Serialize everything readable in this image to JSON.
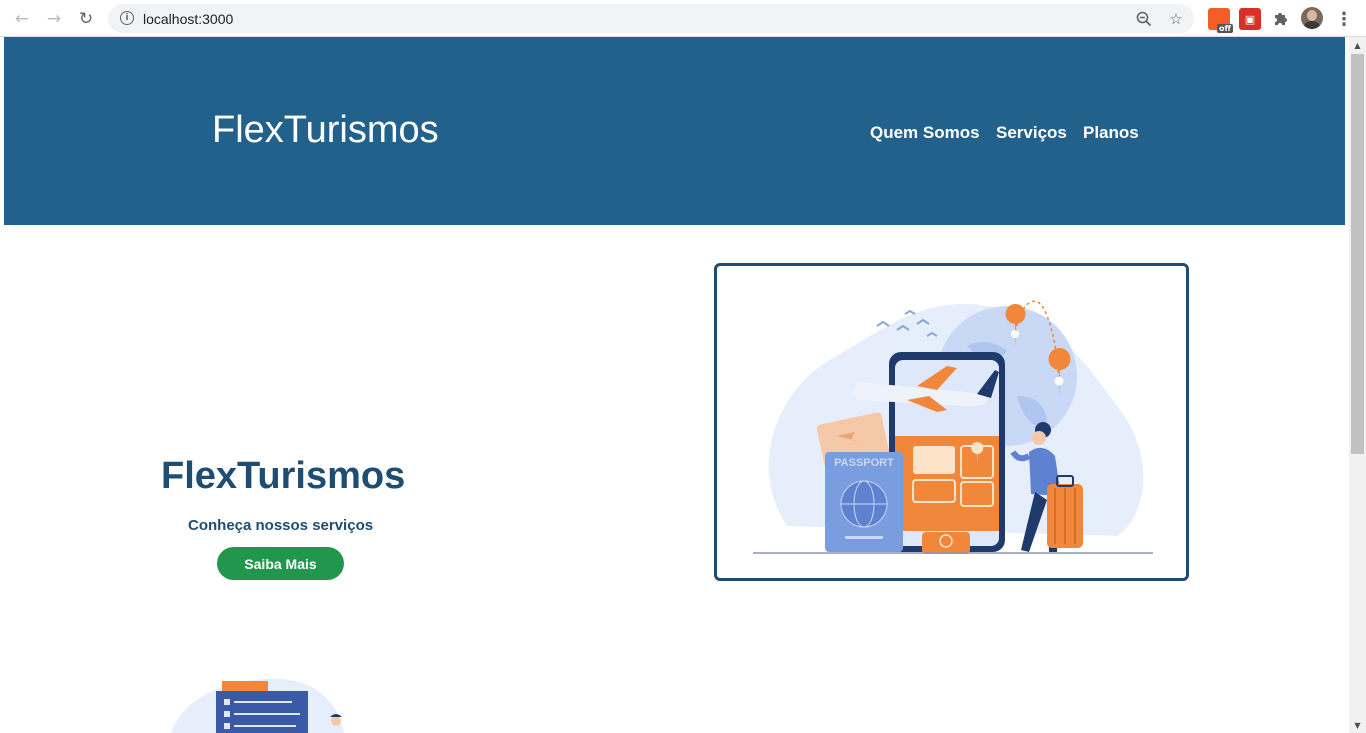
{
  "browser": {
    "url": "localhost:3000",
    "back_icon": "arrow-left-icon",
    "forward_icon": "arrow-right-icon",
    "reload_icon": "reload-icon",
    "ext_off_badge": "off"
  },
  "header": {
    "brand": "FlexTurismos",
    "nav": [
      {
        "label": "Quem Somos"
      },
      {
        "label": "Serviços"
      },
      {
        "label": "Planos"
      }
    ],
    "bg_color": "#22618c"
  },
  "hero": {
    "title": "FlexTurismos",
    "subtitle": "Conheça nossos serviços",
    "button_label": "Saiba Mais",
    "button_color": "#22964d",
    "title_color": "#1f4d72",
    "illustration": {
      "passport_text": "PASSPORT"
    }
  }
}
